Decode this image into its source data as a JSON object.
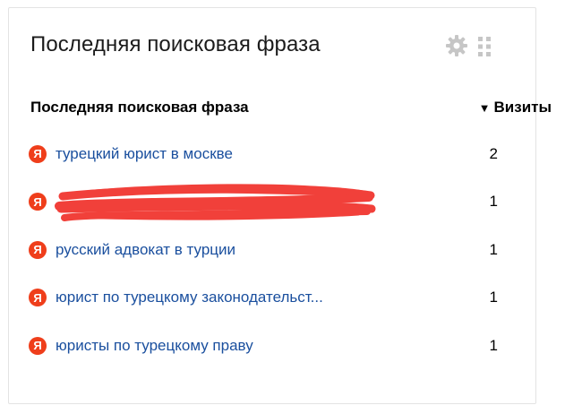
{
  "widget": {
    "title": "Последняя поисковая фраза",
    "icons": {
      "settings": "gear-icon",
      "drag": "drag-handle-icon"
    }
  },
  "table": {
    "col_phrase": "Последняя поисковая фраза",
    "col_visits": "Визиты",
    "sort_indicator": "▼",
    "rows": [
      {
        "engine": "Я",
        "phrase": "турецкий юрист в москве",
        "visits": "2"
      },
      {
        "engine": "Я",
        "phrase": "",
        "visits": "1",
        "redacted": true
      },
      {
        "engine": "Я",
        "phrase": "русский адвокат в турции",
        "visits": "1"
      },
      {
        "engine": "Я",
        "phrase": "юрист по турецкому законодательст...",
        "visits": "1"
      },
      {
        "engine": "Я",
        "phrase": "юристы по турецкому праву",
        "visits": "1"
      }
    ]
  },
  "colors": {
    "link": "#1a4f9e",
    "badge": "#ef3e1b",
    "redaction": "#f0302a"
  }
}
